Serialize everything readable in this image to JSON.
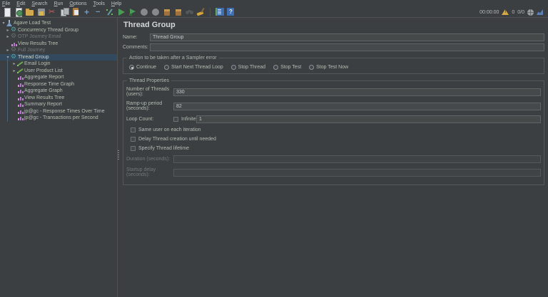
{
  "menubar": {
    "items": [
      "File",
      "Edit",
      "Search",
      "Run",
      "Options",
      "Tools",
      "Help"
    ]
  },
  "toolbar": {
    "icons": [
      "new-file",
      "templates",
      "open-file",
      "save",
      "cut",
      "copy",
      "paste",
      "expand-all",
      "collapse-all",
      "toggle",
      "start",
      "start-no-timers",
      "stop",
      "shutdown",
      "clear",
      "clear-all",
      "search",
      "search-reset",
      "function-helper",
      "help"
    ]
  },
  "statusbar": {
    "elapsed_time": "00:00:00",
    "warning_count": "0",
    "active_threads": "0/0",
    "icons": [
      "log-warning-icon",
      "status-globe-icon",
      "status-chart-icon"
    ]
  },
  "tree": {
    "items": [
      {
        "label": "Agave Load Test",
        "icon": "test-plan-flask",
        "level": 0,
        "state": "expanded"
      },
      {
        "label": "Concurrency Thread Group",
        "icon": "thread-group-gear",
        "level": 1,
        "state": "collapsed"
      },
      {
        "label": "OTP Journey Email",
        "icon": "thread-group-gear",
        "level": 1,
        "state": "collapsed",
        "disabled": true
      },
      {
        "label": "View Results Tree",
        "icon": "chart",
        "level": 1
      },
      {
        "label": "Full Journey",
        "icon": "thread-group-gear",
        "level": 1,
        "state": "collapsed",
        "disabled": true
      },
      {
        "label": "Thread Group",
        "icon": "thread-group-gear",
        "level": 1,
        "state": "expanded",
        "selected": true
      },
      {
        "label": "Email Login",
        "icon": "sampler",
        "level": 2,
        "state": "collapsed"
      },
      {
        "label": "User Product List",
        "icon": "sampler",
        "level": 2,
        "state": "collapsed"
      },
      {
        "label": "Aggregate Report",
        "icon": "chart",
        "level": 2
      },
      {
        "label": "Response Time Graph",
        "icon": "chart",
        "level": 2
      },
      {
        "label": "Aggregate Graph",
        "icon": "chart",
        "level": 2
      },
      {
        "label": "View Results Tree",
        "icon": "chart",
        "level": 2
      },
      {
        "label": "Summary Report",
        "icon": "chart",
        "level": 2
      },
      {
        "label": "jp@gc - Response Times Over Time",
        "icon": "chart",
        "level": 2
      },
      {
        "label": "jp@gc - Transactions per Second",
        "icon": "chart",
        "level": 2
      }
    ]
  },
  "thread_group": {
    "title": "Thread Group",
    "name_label": "Name:",
    "name_value": "Thread Group",
    "comments_label": "Comments:",
    "comments_value": "",
    "action_group_title": "Action to be taken after a Sampler error",
    "action_options": [
      {
        "label": "Continue",
        "selected": true
      },
      {
        "label": "Start Next Thread Loop",
        "selected": false
      },
      {
        "label": "Stop Thread",
        "selected": false
      },
      {
        "label": "Stop Test",
        "selected": false
      },
      {
        "label": "Stop Test Now",
        "selected": false
      }
    ],
    "properties_group_title": "Thread Properties",
    "num_threads_label": "Number of Threads (users):",
    "num_threads_value": "330",
    "rampup_label": "Ramp-up period (seconds):",
    "rampup_value": "82",
    "loop_label": "Loop Count:",
    "infinite_label": "Infinite",
    "infinite_checked": false,
    "loop_value": "1",
    "checkboxes": [
      {
        "label": "Same user on each iteration",
        "checked": false
      },
      {
        "label": "Delay Thread creation until needed",
        "checked": false
      },
      {
        "label": "Specify Thread lifetime",
        "checked": false
      }
    ],
    "duration_label": "Duration (seconds):",
    "duration_value": "",
    "startup_label": "Startup delay (seconds):",
    "startup_value": ""
  },
  "colors": {
    "background": "#3c3f41",
    "field_background": "#45494a",
    "selection": "#33495e",
    "accent_green": "#499c54",
    "warning_yellow": "#d8a93d",
    "gear_teal": "#4ba6a6",
    "chart_pink": "#c183cf"
  }
}
